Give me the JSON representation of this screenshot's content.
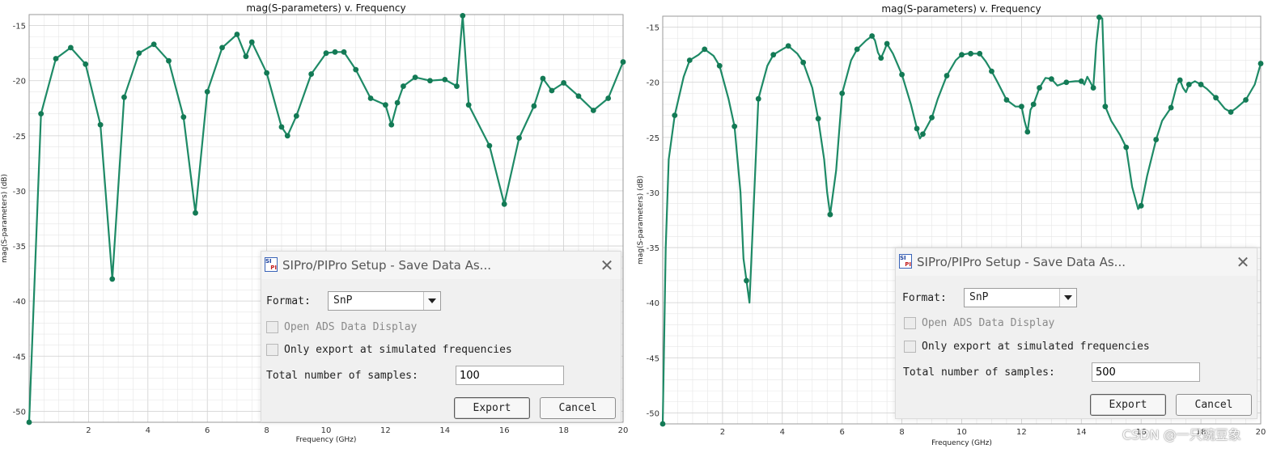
{
  "charts": [
    {
      "title": "mag(S-parameters) v. Frequency",
      "xlabel": "Frequency (GHz)",
      "ylabel": "mag(S-parameters) (dB)",
      "xticks": [
        "2",
        "4",
        "6",
        "8",
        "10",
        "12",
        "14",
        "16",
        "18",
        "20"
      ],
      "yticks": [
        "-15",
        "-20",
        "-25",
        "-30",
        "-35",
        "-40",
        "-45",
        "-50"
      ],
      "dialog": {
        "title": "SIPro/PIPro Setup - Save Data As...",
        "format_label": "Format:",
        "format_value": "SnP",
        "open_ads_label": "Open ADS Data Display",
        "only_export_label": "Only export at simulated frequencies",
        "samples_label": "Total number of samples:",
        "samples_value": "100",
        "export_label": "Export",
        "cancel_label": "Cancel"
      }
    },
    {
      "title": "mag(S-parameters) v. Frequency",
      "xlabel": "Frequency (GHz)",
      "ylabel": "mag(S-parameters) (dB)",
      "xticks": [
        "2",
        "4",
        "6",
        "8",
        "10",
        "12",
        "14",
        "16",
        "18",
        "20"
      ],
      "yticks": [
        "-15",
        "-20",
        "-25",
        "-30",
        "-35",
        "-40",
        "-45",
        "-50"
      ],
      "dialog": {
        "title": "SIPro/PIPro Setup - Save Data As...",
        "format_label": "Format:",
        "format_value": "SnP",
        "open_ads_label": "Open ADS Data Display",
        "only_export_label": "Only export at simulated frequencies",
        "samples_label": "Total number of samples:",
        "samples_value": "500",
        "export_label": "Export",
        "cancel_label": "Cancel"
      }
    }
  ],
  "watermark": "CSDN @一只豌豆象",
  "colors": {
    "trace": "#1e8a66",
    "marker": "#137a55",
    "dialog_bg": "#f0f0f0"
  },
  "chart_data": [
    {
      "type": "line",
      "title": "mag(S-parameters) v. Frequency",
      "xlabel": "Frequency (GHz)",
      "ylabel": "mag(S-parameters) (dB)",
      "xlim": [
        0,
        20
      ],
      "ylim": [
        -51,
        -14
      ],
      "grid": true,
      "series": [
        {
          "x": [
            0.0,
            0.4,
            0.9,
            1.4,
            1.9,
            2.4,
            2.8,
            3.2,
            3.7,
            4.2,
            4.7,
            5.2,
            5.6,
            6.0,
            6.5,
            7.0,
            7.3,
            7.5,
            8.0,
            8.5,
            8.7,
            9.0,
            9.5,
            10.0,
            10.3,
            10.6,
            11.0,
            11.5,
            12.0,
            12.2,
            12.4,
            12.6,
            13.0,
            13.5,
            14.0,
            14.4,
            14.6,
            14.8,
            15.5,
            16.0,
            16.5,
            17.0,
            17.3,
            17.6,
            18.0,
            18.5,
            19.0,
            19.5,
            20.0
          ],
          "y": [
            -51,
            -23,
            -18,
            -17,
            -18.5,
            -24,
            -38,
            -21.5,
            -17.5,
            -16.7,
            -18.2,
            -23.3,
            -32,
            -21,
            -17,
            -15.8,
            -17.8,
            -16.5,
            -19.3,
            -24.2,
            -25,
            -23.2,
            -19.4,
            -17.5,
            -17.4,
            -17.4,
            -19,
            -21.6,
            -22.2,
            -24,
            -22,
            -20.5,
            -19.7,
            -20,
            -19.9,
            -20.5,
            -14.1,
            -22.2,
            -25.9,
            -31.2,
            -25.2,
            -22.3,
            -19.8,
            -20.9,
            -20.2,
            -21.4,
            -22.7,
            -21.6,
            -18.3
          ]
        }
      ],
      "markers": {
        "x": [
          0.0,
          0.4,
          0.9,
          1.4,
          1.9,
          2.4,
          2.8,
          3.2,
          3.7,
          4.2,
          4.7,
          5.2,
          5.6,
          6.0,
          6.5,
          7.0,
          7.3,
          7.5,
          8.0,
          8.5,
          8.7,
          9.0,
          9.5,
          10.0,
          10.3,
          10.6,
          11.0,
          11.5,
          12.0,
          12.2,
          12.4,
          12.6,
          13.0,
          13.5,
          14.0,
          14.4,
          14.6,
          14.8,
          15.5,
          16.0,
          16.5,
          17.0,
          17.3,
          17.6,
          18.0,
          18.5,
          19.0,
          19.5,
          20.0
        ]
      }
    },
    {
      "type": "line",
      "title": "mag(S-parameters) v. Frequency",
      "xlabel": "Frequency (GHz)",
      "ylabel": "mag(S-parameters) (dB)",
      "xlim": [
        0,
        20
      ],
      "ylim": [
        -51,
        -14
      ],
      "grid": true,
      "series": [
        {
          "x": [
            0.0,
            0.1,
            0.2,
            0.4,
            0.7,
            0.9,
            1.2,
            1.4,
            1.7,
            1.9,
            2.2,
            2.4,
            2.6,
            2.7,
            2.8,
            2.9,
            3.2,
            3.5,
            3.7,
            4.0,
            4.2,
            4.5,
            4.7,
            5.0,
            5.2,
            5.4,
            5.5,
            5.6,
            5.8,
            6.0,
            6.3,
            6.5,
            6.8,
            7.0,
            7.1,
            7.2,
            7.3,
            7.4,
            7.5,
            7.7,
            8.0,
            8.3,
            8.5,
            8.6,
            8.7,
            9.0,
            9.2,
            9.5,
            9.8,
            10.0,
            10.2,
            10.4,
            10.6,
            10.8,
            11.0,
            11.2,
            11.5,
            11.8,
            12.0,
            12.1,
            12.2,
            12.3,
            12.4,
            12.6,
            12.8,
            13.0,
            13.2,
            13.5,
            13.8,
            14.0,
            14.1,
            14.2,
            14.4,
            14.5,
            14.6,
            14.7,
            14.8,
            15.0,
            15.3,
            15.5,
            15.7,
            15.9,
            16.0,
            16.2,
            16.5,
            16.7,
            17.0,
            17.2,
            17.3,
            17.4,
            17.5,
            17.6,
            17.8,
            18.0,
            18.2,
            18.5,
            18.8,
            19.0,
            19.2,
            19.5,
            19.8,
            20.0
          ],
          "y": [
            -51,
            -35,
            -27,
            -23,
            -19.5,
            -18,
            -17.5,
            -17,
            -17.6,
            -18.5,
            -21.5,
            -24,
            -30,
            -36,
            -38,
            -40,
            -21.5,
            -18.5,
            -17.5,
            -17,
            -16.7,
            -17.4,
            -18.2,
            -20.5,
            -23.3,
            -27,
            -30,
            -32,
            -28,
            -21,
            -18,
            -17,
            -16.2,
            -15.8,
            -16.2,
            -17.3,
            -17.8,
            -17.2,
            -16.5,
            -17.4,
            -19.3,
            -22,
            -24.2,
            -25.1,
            -24.7,
            -23.2,
            -21.5,
            -19.4,
            -18,
            -17.5,
            -17.4,
            -17.4,
            -17.4,
            -18.1,
            -19,
            -20,
            -21.6,
            -22.2,
            -22.2,
            -23.5,
            -24.5,
            -22.5,
            -22,
            -20.5,
            -19.6,
            -19.7,
            -20.3,
            -20,
            -19.9,
            -19.9,
            -20.2,
            -19.5,
            -20.5,
            -16.5,
            -14.1,
            -14.2,
            -22.2,
            -23.5,
            -24.8,
            -25.9,
            -29.5,
            -31.5,
            -31.2,
            -28.5,
            -25.2,
            -23.5,
            -22.3,
            -20.2,
            -19.8,
            -20.5,
            -20.9,
            -20.2,
            -19.9,
            -20.2,
            -20.6,
            -21.4,
            -22.4,
            -22.7,
            -22.3,
            -21.6,
            -20.2,
            -18.3
          ]
        }
      ],
      "markers": {
        "x": [
          0.0,
          0.4,
          0.9,
          1.4,
          1.9,
          2.4,
          2.8,
          3.2,
          3.7,
          4.2,
          4.7,
          5.2,
          5.6,
          6.0,
          6.5,
          7.0,
          7.3,
          7.5,
          8.0,
          8.5,
          8.7,
          9.0,
          9.5,
          10.0,
          10.3,
          10.6,
          11.0,
          11.5,
          12.0,
          12.2,
          12.4,
          12.6,
          13.0,
          13.5,
          14.0,
          14.4,
          14.6,
          14.8,
          15.5,
          16.0,
          16.5,
          17.0,
          17.3,
          17.6,
          18.0,
          18.5,
          19.0,
          19.5,
          20.0
        ]
      }
    }
  ]
}
